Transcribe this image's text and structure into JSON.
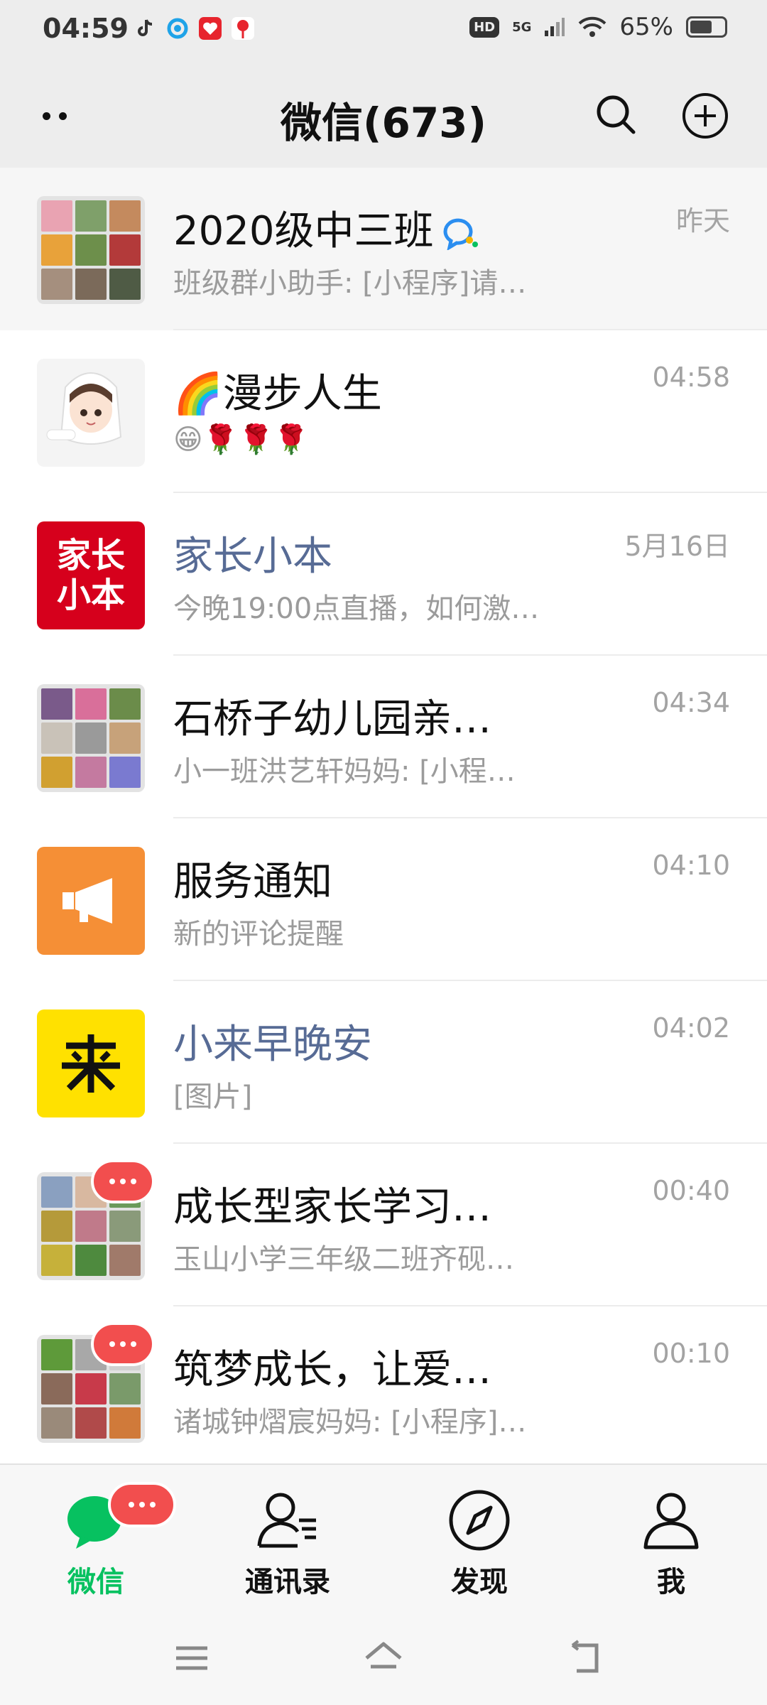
{
  "status_bar": {
    "time": "04:59",
    "hd": "HD",
    "network": "5G",
    "battery": "65%",
    "battery_level": 0.65,
    "app_icons": [
      "tiktok-icon",
      "browser-icon",
      "health-app-icon",
      "map-pin-app-icon"
    ]
  },
  "header": {
    "title": "微信(673)",
    "icons": [
      "more-dots-icon",
      "search-icon",
      "add-icon"
    ]
  },
  "chats": [
    {
      "name": "2020级中三班",
      "preview": "班级群小助手: [小程序]请…",
      "time": "昨天",
      "pinned": true,
      "verified": true
    },
    {
      "name": "🌈漫步人生",
      "preview": "😁🌹🌹🌹",
      "time": "04:58"
    },
    {
      "name": "家长小本",
      "preview": "今晚19:00点直播，如何激…",
      "time": "5月16日",
      "official": true,
      "logo_text": "家长小本"
    },
    {
      "name": "石桥子幼儿园亲…",
      "preview": "小一班洪艺轩妈妈: [小程…",
      "time": "04:34"
    },
    {
      "name": "服务通知",
      "preview": "新的评论提醒",
      "time": "04:10"
    },
    {
      "name": "小来早晚安",
      "preview": "[图片]",
      "time": "04:02",
      "official": true
    },
    {
      "name": "成长型家长学习…",
      "preview": "玉山小学三年级二班齐砚…",
      "time": "00:40",
      "muted_badge": true
    },
    {
      "name": "筑梦成长，让爱…",
      "preview": "诸城钟熠宸妈妈: [小程序]…",
      "time": "00:10",
      "muted_badge": true
    }
  ],
  "tabs": [
    {
      "label": "微信",
      "active": true,
      "icon": "chat-bubble-icon"
    },
    {
      "label": "通讯录",
      "icon": "contacts-icon"
    },
    {
      "label": "发现",
      "icon": "compass-icon"
    },
    {
      "label": "我",
      "icon": "person-icon"
    }
  ],
  "colors": {
    "accent_green": "#07c160",
    "badge_red": "#f24e4e",
    "official_blue": "#576b95",
    "service_orange": "#f58f36",
    "logo_red": "#d6001c",
    "logo_yellow": "#ffe100"
  }
}
